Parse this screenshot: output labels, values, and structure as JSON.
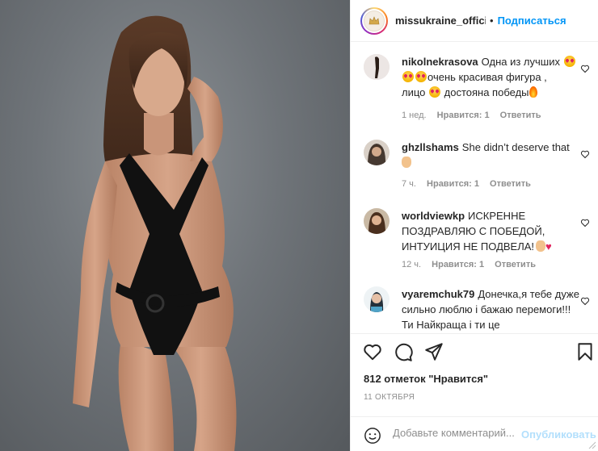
{
  "post": {
    "photo_alt": "photo"
  },
  "header": {
    "username": "missukraine_official",
    "separator": "•",
    "follow_label": "Подписаться"
  },
  "comments": [
    {
      "username": "nikolnekrasova",
      "text_1": "Одна из лучших",
      "text_2": "очень красивая фигура ,",
      "text_3": "лицо",
      "text_4": "достояна победы",
      "time": "1 нед.",
      "likes": "Нравится: 1",
      "reply": "Ответить"
    },
    {
      "username": "ghzllshams",
      "text": "She didn’t deserve that",
      "time": "7 ч.",
      "likes": "Нравится: 1",
      "reply": "Ответить"
    },
    {
      "username": "worldviewkp",
      "text": "ИСКРЕННЕ ПОЗДРАВЛЯЮ С ПОБЕДОЙ, ИНТУИЦИЯ НЕ ПОДВЕЛА!",
      "time": "12 ч.",
      "likes": "Нравится: 1",
      "reply": "Ответить"
    },
    {
      "username": "vyaremchuk79",
      "text": "Донечка,я тебе дуже сильно люблю і бажаю перемоги!!! Ти Найкраща і ти це"
    }
  ],
  "actions": {
    "likes_text": "812 отметок \"Нравится\"",
    "date": "11 ОКТЯБРЯ",
    "comment_placeholder": "Добавьте комментарий...",
    "publish_label": "Опубликовать"
  },
  "colors": {
    "accent": "#0095f6",
    "publish_disabled": "#b2dffc",
    "muted": "#8e8e8e"
  },
  "icons": [
    "heart-icon",
    "comment-icon",
    "share-icon",
    "bookmark-icon",
    "smiley-icon"
  ]
}
